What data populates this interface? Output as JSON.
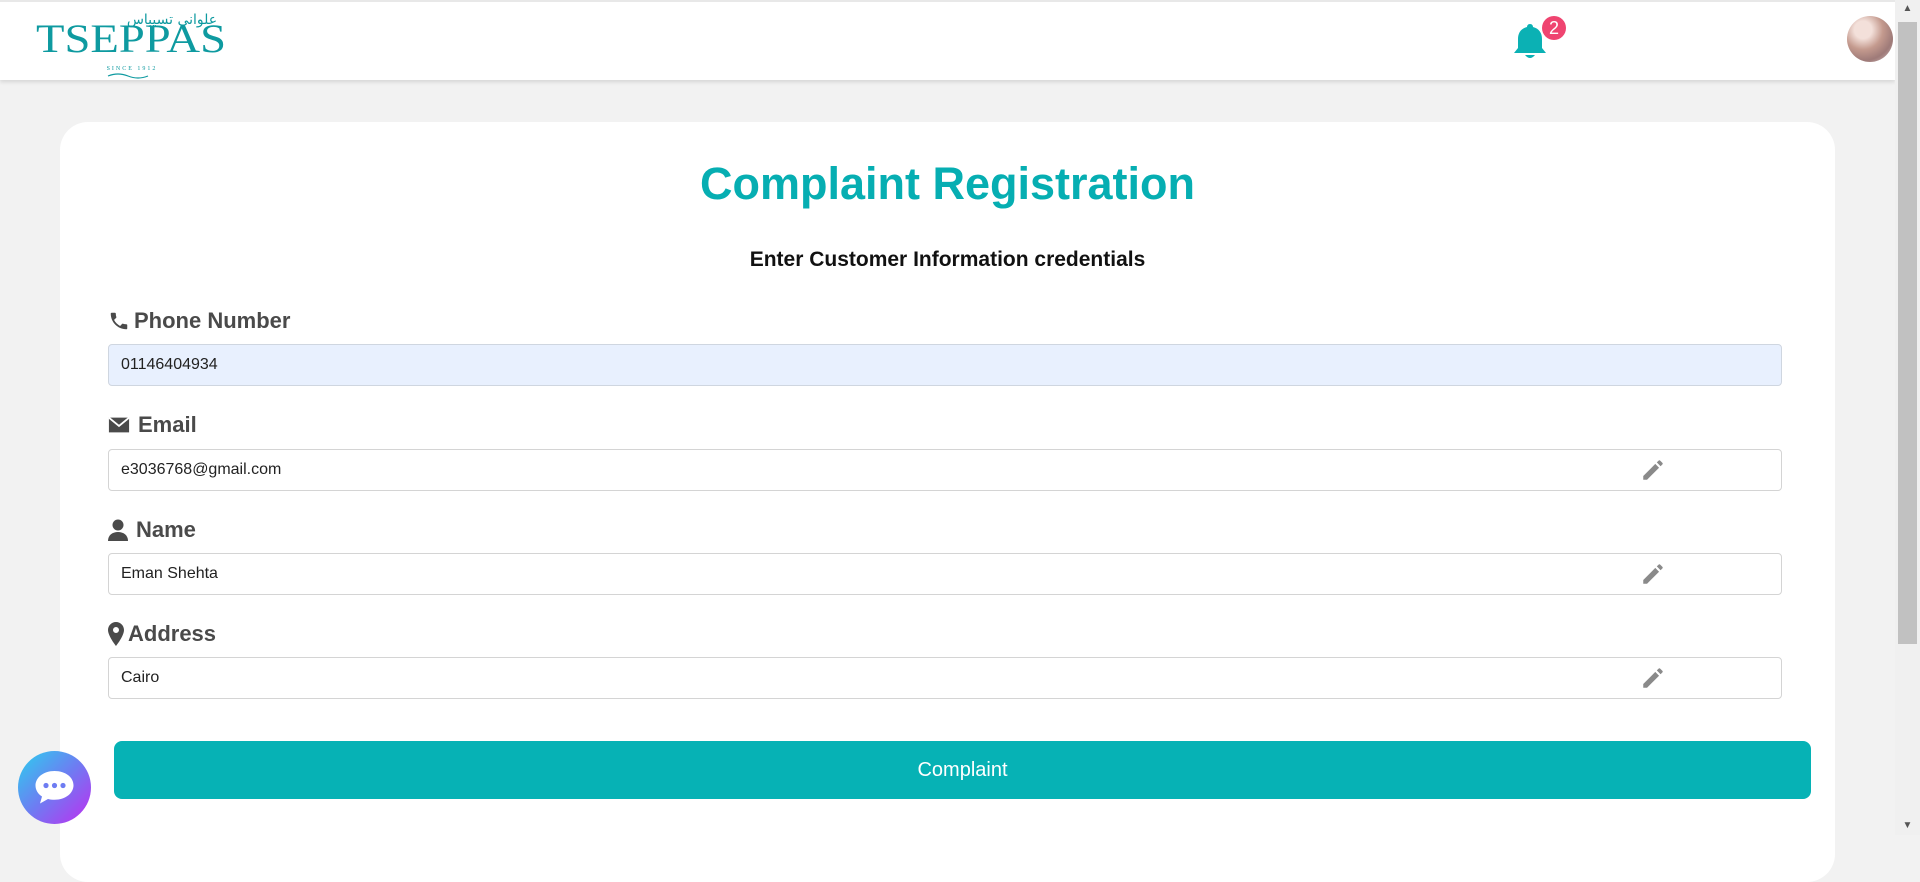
{
  "header": {
    "logo_text": "TSEPPAS",
    "logo_arabic": "علوانى تسيباس",
    "logo_since": "SINCE 1912",
    "notification_count": "2"
  },
  "form": {
    "title": "Complaint Registration",
    "subtitle": "Enter Customer Information credentials",
    "fields": [
      {
        "label": "Phone Number",
        "value": "01146404934",
        "icon": "phone-icon"
      },
      {
        "label": "Email",
        "value": "e3036768@gmail.com",
        "icon": "envelope-icon"
      },
      {
        "label": "Name",
        "value": "Eman Shehta",
        "icon": "user-icon"
      },
      {
        "label": "Address",
        "value": "Cairo",
        "icon": "map-marker-icon"
      }
    ],
    "submit_label": "Complaint"
  },
  "colors": {
    "accent": "#06b2b5",
    "badge": "#ef4470",
    "autofill": "#e8f0fe"
  }
}
